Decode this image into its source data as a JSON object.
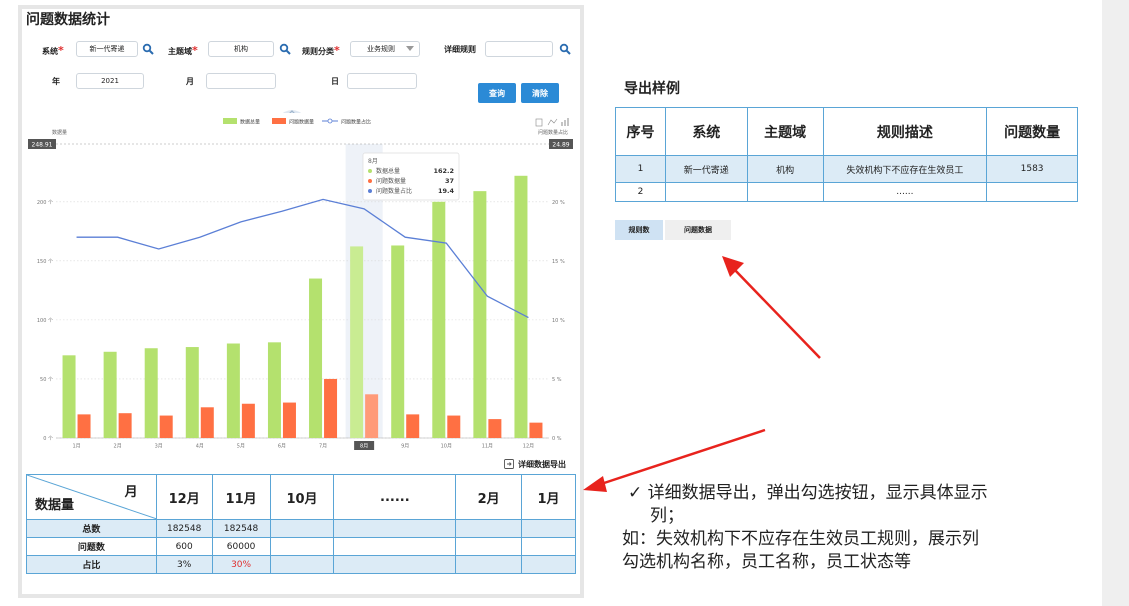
{
  "panel": {
    "title": "问题数据统计",
    "filters": {
      "system_label": "系统",
      "system_value": "新一代寄递",
      "domain_label": "主题域",
      "domain_value": "机构",
      "category_label": "规则分类",
      "category_value": "业务规则",
      "detail_label": "详细规则",
      "detail_value": "",
      "year_label": "年",
      "year_value": "2021",
      "month_label": "月",
      "month_value": "",
      "day_label": "日",
      "day_value": "",
      "query_button": "查询",
      "clear_button": "清除",
      "required_mark": "*"
    },
    "export_detail_label": "详细数据导出"
  },
  "chart_data": {
    "type": "bar",
    "title": "",
    "ylabel": "数据量",
    "y2label": "问题数量占比",
    "ylim": [
      0,
      248.91
    ],
    "y2lim": [
      0,
      24.89
    ],
    "y_top_label": "248.91",
    "y2_top_label": "24.89",
    "yticks": [
      {
        "v": 0,
        "label": "0 个"
      },
      {
        "v": 50,
        "label": "50 个"
      },
      {
        "v": 100,
        "label": "100 个"
      },
      {
        "v": 150,
        "label": "150 个"
      },
      {
        "v": 200,
        "label": "200 个"
      }
    ],
    "y2ticks": [
      {
        "v": 0,
        "label": "0 %"
      },
      {
        "v": 5,
        "label": "5 %"
      },
      {
        "v": 10,
        "label": "10 %"
      },
      {
        "v": 15,
        "label": "15 %"
      },
      {
        "v": 20,
        "label": "20 %"
      }
    ],
    "categories": [
      "1月",
      "2月",
      "3月",
      "4月",
      "5月",
      "6月",
      "7月",
      "8月",
      "9月",
      "10月",
      "11月",
      "12月"
    ],
    "highlight_index": 7,
    "series": [
      {
        "name": "数据总量",
        "kind": "bar",
        "color": "#b4e16e",
        "values": [
          70,
          73,
          76,
          77,
          80,
          81,
          135,
          162.2,
          163,
          200,
          209,
          222
        ]
      },
      {
        "name": "问题数据量",
        "kind": "bar",
        "color": "#ff7043",
        "values": [
          20,
          21,
          19,
          26,
          29,
          30,
          50,
          37,
          20,
          19,
          16,
          13
        ]
      },
      {
        "name": "问题数量占比",
        "kind": "line",
        "color": "#5b7fd6",
        "values": [
          17,
          17,
          16,
          17,
          18.3,
          19.2,
          20.2,
          19.4,
          17,
          16.5,
          12,
          10.2
        ]
      }
    ],
    "tooltip": {
      "title": "8月",
      "rows": [
        {
          "label": "数据总量",
          "value": "162.2",
          "color": "#b4e16e"
        },
        {
          "label": "问题数据量",
          "value": "37",
          "color": "#ff7043"
        },
        {
          "label": "问题数量占比",
          "value": "19.4",
          "color": "#5b7fd6"
        }
      ]
    },
    "legend_position": "top-center"
  },
  "main_table": {
    "corner_month": "月",
    "corner_data": "数据量",
    "columns": [
      "12月",
      "11月",
      "10月",
      "......",
      "2月",
      "1月"
    ],
    "rows": [
      {
        "label": "总数",
        "cells": [
          "182548",
          "182548",
          "",
          "",
          "",
          ""
        ]
      },
      {
        "label": "问题数",
        "cells": [
          "600",
          "60000",
          "",
          "",
          "",
          ""
        ]
      },
      {
        "label": "占比",
        "cells": [
          "3%",
          "30%",
          "",
          "",
          "",
          ""
        ]
      }
    ]
  },
  "export_sample": {
    "title": "导出样例",
    "headers": [
      "序号",
      "系统",
      "主题域",
      "规则描述",
      "问题数量"
    ],
    "row1": [
      "1",
      "新一代寄递",
      "机构",
      "失效机构下不应存在生效员工",
      "1583"
    ],
    "row2": [
      "2",
      "",
      "",
      "......",
      ""
    ],
    "tabs": [
      "规则数",
      "问题数据"
    ]
  },
  "notes": {
    "check": "✓",
    "line1": "详细数据导出，弹出勾选按钮，显示具体显示",
    "line1b": "列；",
    "line2": "如：失效机构下不应存在生效员工规则，展示列",
    "line3": "勾选机构名称，员工名称，员工状态等"
  },
  "colors": {
    "accent": "#2b8ad6",
    "table_border": "#5aa5d6",
    "row_fill": "#dcebf6",
    "arrow": "#e8231d",
    "red_value": "#e03030"
  }
}
